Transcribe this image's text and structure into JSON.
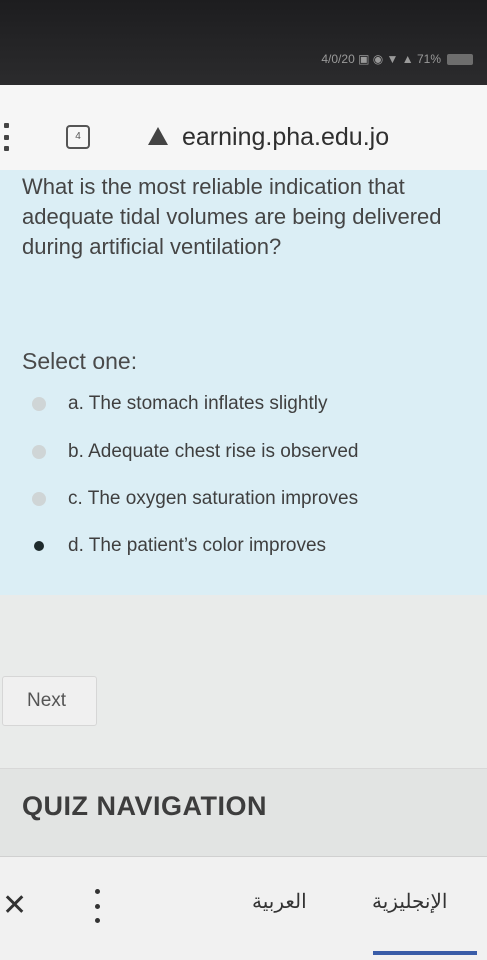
{
  "status_bar": {
    "text": "4/0/20 ▣ ◉ ▼ ▲ 71%",
    "battery_icon": "battery-icon"
  },
  "browser": {
    "url": "earning.pha.edu.jo",
    "tabs_count": "4",
    "menu_icon": "vertical-dots-icon",
    "security_icon": "warning-icon"
  },
  "question": {
    "text": "What is the most reliable indication that adequate tidal volumes are being delivered during artificial ventilation?",
    "select_label": "Select one:",
    "options": [
      {
        "label": "a. The stomach inflates slightly",
        "selected": false
      },
      {
        "label": "b. Adequate chest rise is observed",
        "selected": false
      },
      {
        "label": "c. The oxygen saturation improves",
        "selected": false
      },
      {
        "label": "d. The patient’s color improves",
        "selected": true
      }
    ],
    "next_label": "Next"
  },
  "quiz_nav": {
    "title": "QUIZ NAVIGATION"
  },
  "footer": {
    "arabic_label": "العربية",
    "english_label": "الإنجليزية",
    "close_icon": "close-icon",
    "more_icon": "more-vertical-icon"
  },
  "colors": {
    "question_background": "#dbeef5",
    "active_language_underline": "#3a5da8"
  }
}
